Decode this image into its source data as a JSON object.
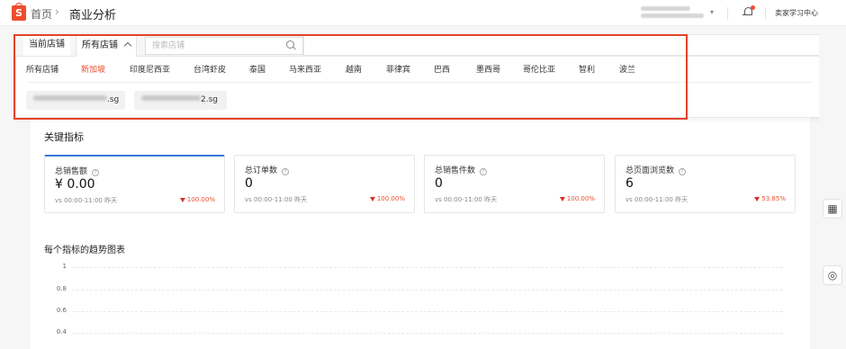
{
  "header": {
    "breadcrumb_home": "首页",
    "breadcrumb_sep": "›",
    "page_title": "商业分析",
    "learn_center": "卖家学习中心",
    "logo_letter": "S",
    "account_caret": "▾"
  },
  "shop_selector": {
    "tab_current": "当前店铺",
    "tab_all": "所有店铺",
    "search_placeholder": "搜索店铺",
    "regions": [
      "所有店铺",
      "新加坡",
      "印度尼西亚",
      "台湾虾皮",
      "泰国",
      "马来西亚",
      "越南",
      "菲律宾",
      "巴西",
      "墨西哥",
      "哥伦比亚",
      "智利",
      "波兰"
    ],
    "active_region": "新加坡",
    "shop_chips": [
      ".sg",
      "2.sg"
    ]
  },
  "key_metrics": {
    "title": "关键指标",
    "help_glyph": "?",
    "cards": [
      {
        "label": "总销售额",
        "value": "¥ 0.00",
        "compare": "vs 00:00-11:00 昨天",
        "change": "100.00%"
      },
      {
        "label": "总订单数",
        "value": "0",
        "compare": "vs 00:00-11:00 昨天",
        "change": "100.00%"
      },
      {
        "label": "总销售件数",
        "value": "0",
        "compare": "vs 00:00-11:00 昨天",
        "change": "100.00%"
      },
      {
        "label": "总页面浏览数",
        "value": "6",
        "compare": "vs 00:00-11:00 昨天",
        "change": "53.85%"
      }
    ]
  },
  "trend": {
    "title": "每个指标的趋势图表",
    "y_ticks": [
      "1",
      "0.8",
      "0.6",
      "0.4"
    ]
  },
  "colors": {
    "brand": "#ee4d2d",
    "selected_card": "#3a78e0",
    "highlight_box": "#e2432a",
    "down_arrow": "#d93025"
  },
  "icons": {
    "rail_1": "▦",
    "rail_2": "◎"
  }
}
